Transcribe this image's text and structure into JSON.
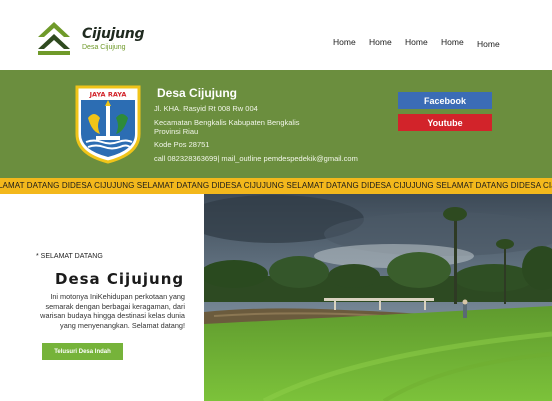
{
  "brand": {
    "name": "Cijujung",
    "subtitle": "Desa Cijujung",
    "accent": "#6f9a2a",
    "dark_green": "#2f4a1f"
  },
  "nav": {
    "items": [
      "Home",
      "Home",
      "Home",
      "Home",
      "Home"
    ]
  },
  "info": {
    "title": "Desa Cijujung",
    "address": "Jl. KHA. Rasyid Rt 008 Rw 004",
    "district_line1": "Kecamatan Bengkalis Kabupaten Bengkalis",
    "district_line2": "Provinsi Riau",
    "postal": "Kode Pos 28751",
    "contact": "call 082328363699| mail_outline pemdespedekik@gmail.com",
    "emblem_banner": "JAYA  RAYA",
    "band_color": "#6b8e3e"
  },
  "social": {
    "facebook_label": "Facebook",
    "youtube_label": "Youtube",
    "facebook_color": "#3b6cb6",
    "youtube_color": "#d2232a"
  },
  "ticker": {
    "text": "LAMAT DATANG DIDESA CIJUJUNG SELAMAT DATANG DIDESA CIJUJUNG SELAMAT DATANG DIDESA CIJUJUNG SELAMAT DATANG DIDESA CIJUJUNG SELAMAT DATANG DIDESA CIJUJUNG",
    "color": "#f3b81c"
  },
  "hero": {
    "kicker": "* SELAMAT DATANG",
    "title": "Desa Cijujung",
    "description": "Ini motonya IniKehidupan perkotaan yang semarak dengan berbagai keragaman, dari warisan budaya hingga destinasi kelas dunia yang menyenangkan. Selamat datang!",
    "button_label": "Telusuri Desa Indah",
    "button_color": "#76b33a"
  }
}
